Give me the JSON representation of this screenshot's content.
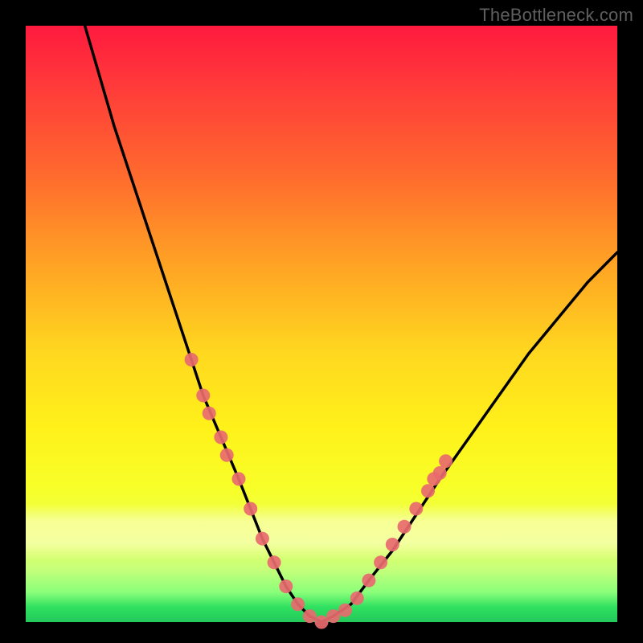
{
  "watermark": "TheBottleneck.com",
  "chart_data": {
    "type": "line",
    "title": "",
    "xlabel": "",
    "ylabel": "",
    "xlim": [
      0,
      100
    ],
    "ylim": [
      0,
      100
    ],
    "series": [
      {
        "name": "curve",
        "x": [
          10,
          15,
          20,
          25,
          28,
          30,
          33,
          36,
          38,
          40,
          42,
          44,
          46,
          48,
          50,
          52,
          55,
          58,
          62,
          66,
          70,
          75,
          80,
          85,
          90,
          95,
          100
        ],
        "values": [
          100,
          83,
          68,
          53,
          44,
          38,
          31,
          24,
          19,
          14,
          10,
          6,
          3,
          1,
          0,
          1,
          3,
          7,
          12,
          18,
          24,
          31,
          38,
          45,
          51,
          57,
          62
        ]
      }
    ],
    "markers_left": [
      {
        "x": 28,
        "y": 44
      },
      {
        "x": 30,
        "y": 38
      },
      {
        "x": 31,
        "y": 35
      },
      {
        "x": 33,
        "y": 31
      },
      {
        "x": 34,
        "y": 28
      },
      {
        "x": 36,
        "y": 24
      },
      {
        "x": 38,
        "y": 19
      },
      {
        "x": 40,
        "y": 14
      },
      {
        "x": 42,
        "y": 10
      },
      {
        "x": 44,
        "y": 6
      }
    ],
    "markers_floor": [
      {
        "x": 46,
        "y": 3
      },
      {
        "x": 48,
        "y": 1
      },
      {
        "x": 50,
        "y": 0
      },
      {
        "x": 52,
        "y": 1
      },
      {
        "x": 54,
        "y": 2
      }
    ],
    "markers_right": [
      {
        "x": 56,
        "y": 4
      },
      {
        "x": 58,
        "y": 7
      },
      {
        "x": 60,
        "y": 10
      },
      {
        "x": 62,
        "y": 13
      },
      {
        "x": 64,
        "y": 16
      },
      {
        "x": 66,
        "y": 19
      },
      {
        "x": 68,
        "y": 22
      },
      {
        "x": 69,
        "y": 24
      },
      {
        "x": 70,
        "y": 25
      },
      {
        "x": 71,
        "y": 27
      }
    ],
    "marker_color": "#e86a6f",
    "curve_color": "#000000"
  }
}
